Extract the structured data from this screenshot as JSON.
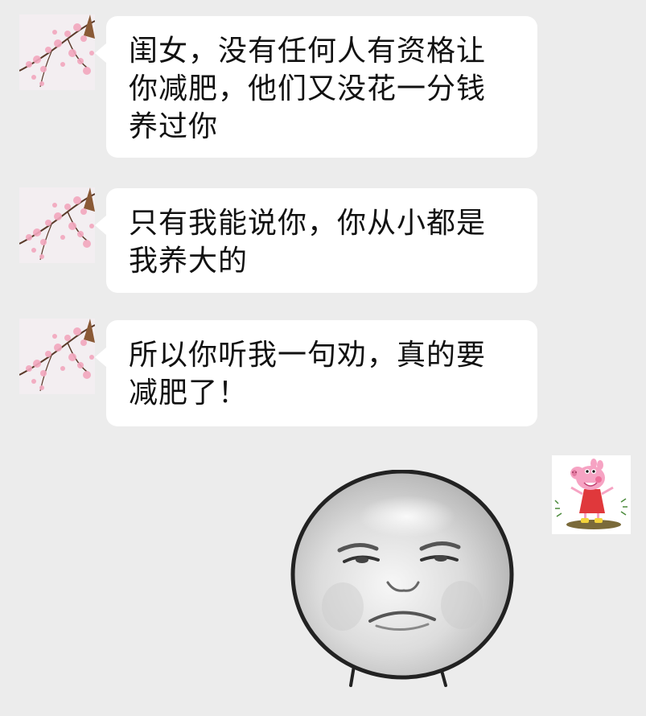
{
  "conversation": {
    "messages": [
      {
        "sender": "other",
        "avatar_icon": "cherry-blossom-avatar-icon",
        "text": "闺女，没有任何人有资格让你减肥，他们又没花一分钱养过你"
      },
      {
        "sender": "other",
        "avatar_icon": "cherry-blossom-avatar-icon",
        "text": "只有我能说你，你从小都是我养大的"
      },
      {
        "sender": "other",
        "avatar_icon": "cherry-blossom-avatar-icon",
        "text": "所以你听我一句劝，真的要减肥了！"
      },
      {
        "sender": "self",
        "avatar_icon": "peppa-pig-avatar-icon",
        "sticker": "sad-round-face-sticker-icon"
      }
    ]
  },
  "colors": {
    "background": "#ececec",
    "bubble": "#ffffff",
    "text": "#111111",
    "blossom": "#f2a7be",
    "peppa_pink": "#f6a3c3",
    "peppa_dress": "#e0383b"
  }
}
